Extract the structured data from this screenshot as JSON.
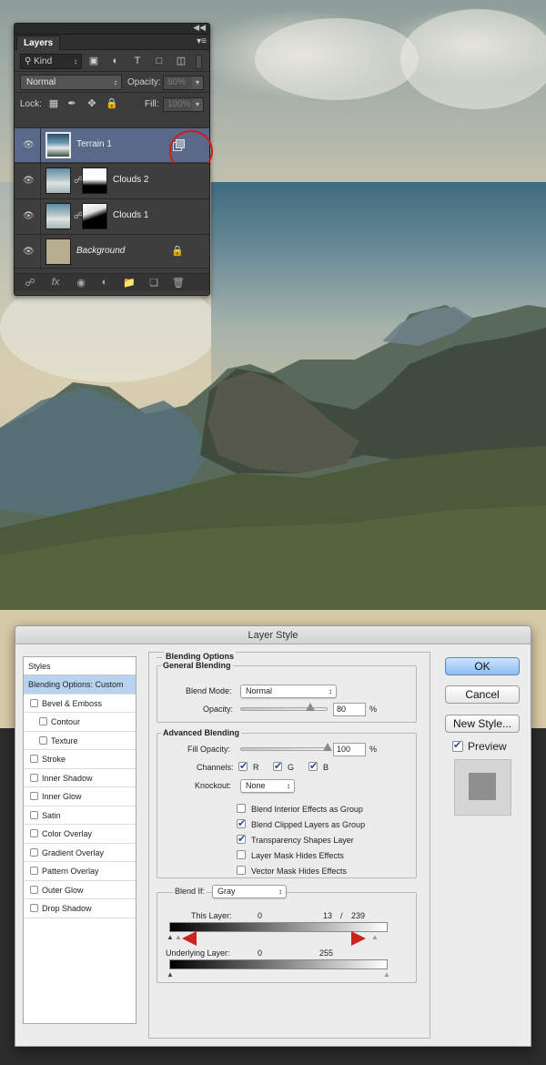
{
  "layers_panel": {
    "tab_label": "Layers",
    "filter_kind": "Kind",
    "blend_mode": "Normal",
    "opacity_label": "Opacity:",
    "opacity_value": "80%",
    "lock_label": "Lock:",
    "fill_label": "Fill:",
    "fill_value": "100%",
    "layers": [
      {
        "name": "Terrain 1",
        "selected": true,
        "clipped": true
      },
      {
        "name": "Clouds 2",
        "selected": false,
        "has_mask": true
      },
      {
        "name": "Clouds 1",
        "selected": false,
        "has_mask": true
      },
      {
        "name": "Background",
        "selected": false,
        "locked": true
      }
    ],
    "annotation_color": "#d11b1b"
  },
  "dialog": {
    "title": "Layer Style",
    "styles_header": "Styles",
    "style_items": [
      {
        "label": "Blending Options: Custom",
        "active": true,
        "checkbox": false,
        "sub": false
      },
      {
        "label": "Bevel & Emboss",
        "active": false,
        "checkbox": true,
        "sub": false
      },
      {
        "label": "Contour",
        "active": false,
        "checkbox": true,
        "sub": true
      },
      {
        "label": "Texture",
        "active": false,
        "checkbox": true,
        "sub": true
      },
      {
        "label": "Stroke",
        "active": false,
        "checkbox": true,
        "sub": false
      },
      {
        "label": "Inner Shadow",
        "active": false,
        "checkbox": true,
        "sub": false
      },
      {
        "label": "Inner Glow",
        "active": false,
        "checkbox": true,
        "sub": false
      },
      {
        "label": "Satin",
        "active": false,
        "checkbox": true,
        "sub": false
      },
      {
        "label": "Color Overlay",
        "active": false,
        "checkbox": true,
        "sub": false
      },
      {
        "label": "Gradient Overlay",
        "active": false,
        "checkbox": true,
        "sub": false
      },
      {
        "label": "Pattern Overlay",
        "active": false,
        "checkbox": true,
        "sub": false
      },
      {
        "label": "Outer Glow",
        "active": false,
        "checkbox": true,
        "sub": false
      },
      {
        "label": "Drop Shadow",
        "active": false,
        "checkbox": true,
        "sub": false
      }
    ],
    "blending_options": {
      "section_title": "Blending Options",
      "general_title": "General Blending",
      "blend_mode_label": "Blend Mode:",
      "blend_mode_value": "Normal",
      "opacity_label": "Opacity:",
      "opacity_value": "80",
      "opacity_fraction": 0.8,
      "percent_sign": "%",
      "advanced_title": "Advanced Blending",
      "fill_opacity_label": "Fill Opacity:",
      "fill_opacity_value": "100",
      "fill_fraction": 1.0,
      "channels_label": "Channels:",
      "channels": [
        "R",
        "G",
        "B"
      ],
      "knockout_label": "Knockout:",
      "knockout_value": "None",
      "options": [
        {
          "label": "Blend Interior Effects as Group",
          "checked": false
        },
        {
          "label": "Blend Clipped Layers as Group",
          "checked": true
        },
        {
          "label": "Transparency Shapes Layer",
          "checked": true
        },
        {
          "label": "Layer Mask Hides Effects",
          "checked": false
        },
        {
          "label": "Vector Mask Hides Effects",
          "checked": false
        }
      ],
      "blend_if_label": "Blend If:",
      "blend_if_value": "Gray",
      "this_layer_label": "This Layer:",
      "this_layer_low": "0",
      "this_layer_split": "13",
      "this_layer_slash": "/",
      "this_layer_high": "239",
      "underlying_label": "Underlying Layer:",
      "underlying_low": "0",
      "underlying_high": "255",
      "arrow_color": "#cc2222"
    },
    "buttons": {
      "ok": "OK",
      "cancel": "Cancel",
      "new_style": "New Style...",
      "preview": "Preview"
    }
  }
}
